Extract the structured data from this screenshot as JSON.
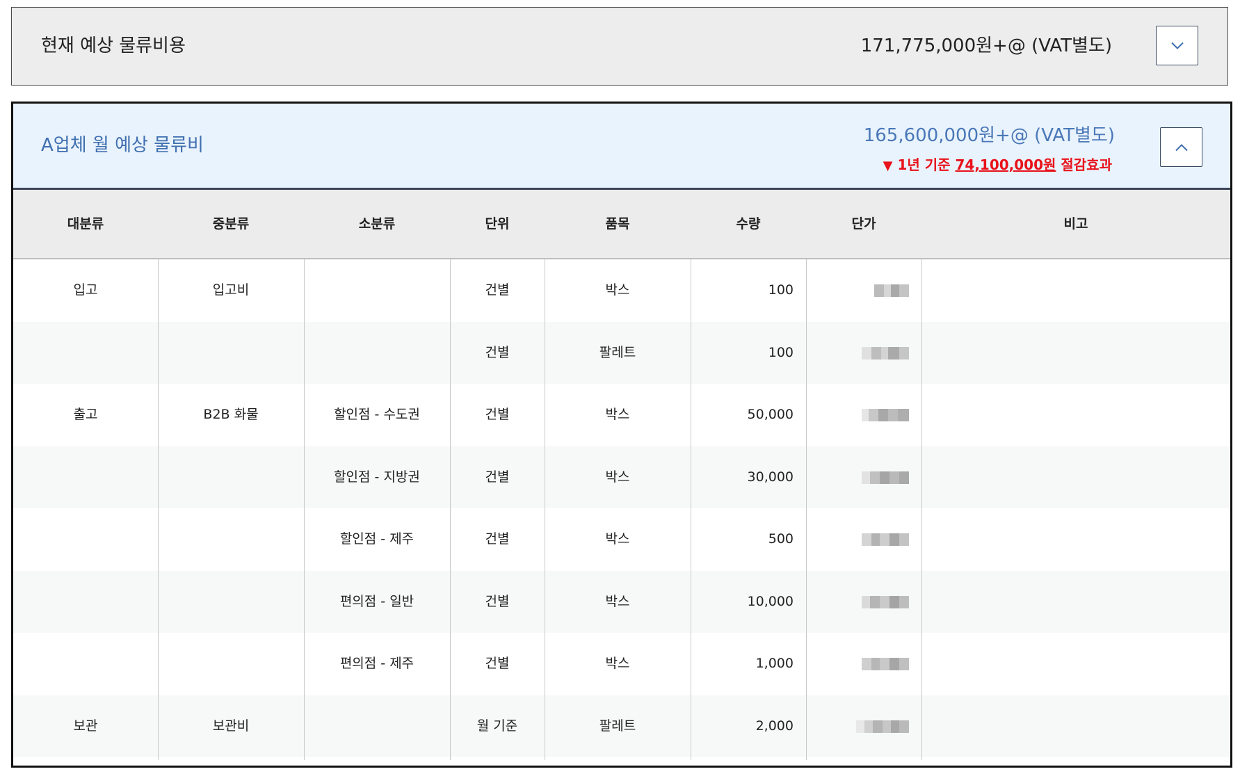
{
  "current": {
    "title": "현재 예상 물류비용",
    "amount": "171,775,000원+@ (VAT별도)",
    "toggle_icon": "chevron-down-icon"
  },
  "company_a": {
    "title": "A업체 월 예상 물류비",
    "amount": "165,600,000원+@ (VAT별도)",
    "saving_arrow": "▼",
    "saving_prefix": "1년 기준 ",
    "saving_amount": "74,100,000원",
    "saving_suffix": " 절감효과",
    "toggle_icon": "chevron-up-icon",
    "accent_color": "#3f6fb0",
    "saving_color": "#e8121a"
  },
  "table": {
    "headers": [
      "대분류",
      "중분류",
      "소분류",
      "단위",
      "품목",
      "수량",
      "단가",
      "비고"
    ],
    "rows": [
      {
        "major": "입고",
        "middle": "입고비",
        "minor": "",
        "unit": "건별",
        "item": "박스",
        "qty": "100",
        "note": ""
      },
      {
        "major": "",
        "middle": "",
        "minor": "",
        "unit": "건별",
        "item": "팔레트",
        "qty": "100",
        "note": ""
      },
      {
        "major": "출고",
        "middle": "B2B 화물",
        "minor": "할인점 - 수도권",
        "unit": "건별",
        "item": "박스",
        "qty": "50,000",
        "note": ""
      },
      {
        "major": "",
        "middle": "",
        "minor": "할인점 - 지방권",
        "unit": "건별",
        "item": "박스",
        "qty": "30,000",
        "note": ""
      },
      {
        "major": "",
        "middle": "",
        "minor": "할인점 - 제주",
        "unit": "건별",
        "item": "박스",
        "qty": "500",
        "note": ""
      },
      {
        "major": "",
        "middle": "",
        "minor": "편의점 - 일반",
        "unit": "건별",
        "item": "박스",
        "qty": "10,000",
        "note": ""
      },
      {
        "major": "",
        "middle": "",
        "minor": "편의점 - 제주",
        "unit": "건별",
        "item": "박스",
        "qty": "1,000",
        "note": ""
      },
      {
        "major": "보관",
        "middle": "보관비",
        "minor": "",
        "unit": "월 기준",
        "item": "팔레트",
        "qty": "2,000",
        "note": ""
      }
    ]
  }
}
